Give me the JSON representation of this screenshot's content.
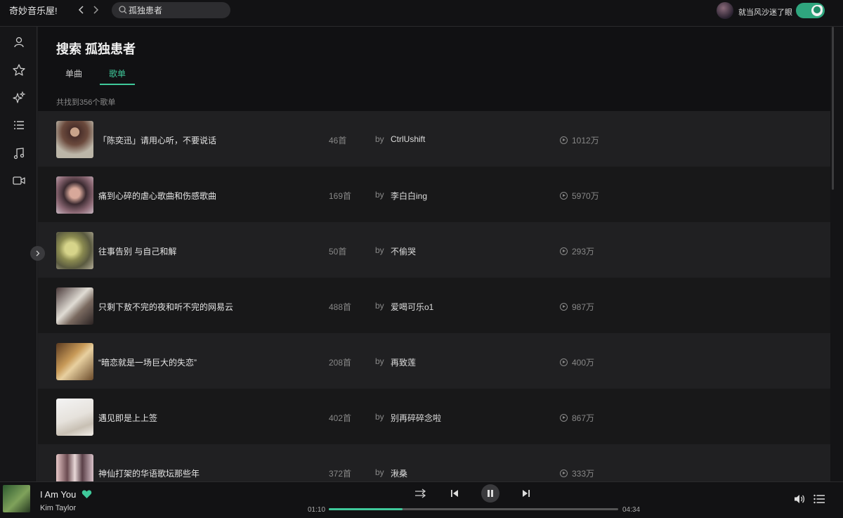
{
  "header": {
    "app_title": "奇妙音乐屋!",
    "back_icon": "chevron-left-icon",
    "forward_icon": "chevron-right-icon",
    "search_value": "孤独患者",
    "username": "就当风沙迷了眼",
    "theme_toggle": "dark-mode-toggle"
  },
  "sidebar": {
    "items": [
      {
        "icon": "user-icon"
      },
      {
        "icon": "star-icon"
      },
      {
        "icon": "sparkle-icon"
      },
      {
        "icon": "list-icon"
      },
      {
        "icon": "music-note-icon"
      },
      {
        "icon": "video-icon"
      }
    ]
  },
  "main": {
    "title": "搜索 孤独患者",
    "tabs": [
      {
        "label": "单曲",
        "active": false
      },
      {
        "label": "歌单",
        "active": true
      }
    ],
    "result_count": "共找到356个歌单",
    "by_label": "by",
    "playlists": [
      {
        "name": "「陈奕迅」请用心听，不要说话",
        "tracks": "46首",
        "creator": "CtrlUshift",
        "plays": "1012万"
      },
      {
        "name": "痛到心碎的虐心歌曲和伤感歌曲",
        "tracks": "169首",
        "creator": "李白白ing",
        "plays": "5970万"
      },
      {
        "name": "往事告别 与自己和解",
        "tracks": "50首",
        "creator": "不偷哭",
        "plays": "293万"
      },
      {
        "name": "只剩下敖不完的夜和听不完的网易云",
        "tracks": "488首",
        "creator": "爱喝可乐o1",
        "plays": "987万"
      },
      {
        "name": "“暗恋就是一场巨大的失恋”",
        "tracks": "208首",
        "creator": "再致莲",
        "plays": "400万"
      },
      {
        "name": "遇见即是上上签",
        "tracks": "402首",
        "creator": "别再碎碎念啦",
        "plays": "867万"
      },
      {
        "name": "神仙打架的华语歌坛那些年",
        "tracks": "372首",
        "creator": "湫桑",
        "plays": "333万"
      }
    ]
  },
  "player": {
    "song": "I Am You",
    "artist": "Kim Taylor",
    "current_time": "01:10",
    "total_time": "04:34",
    "progress": 0.255,
    "accent_color": "#3fc89a"
  }
}
